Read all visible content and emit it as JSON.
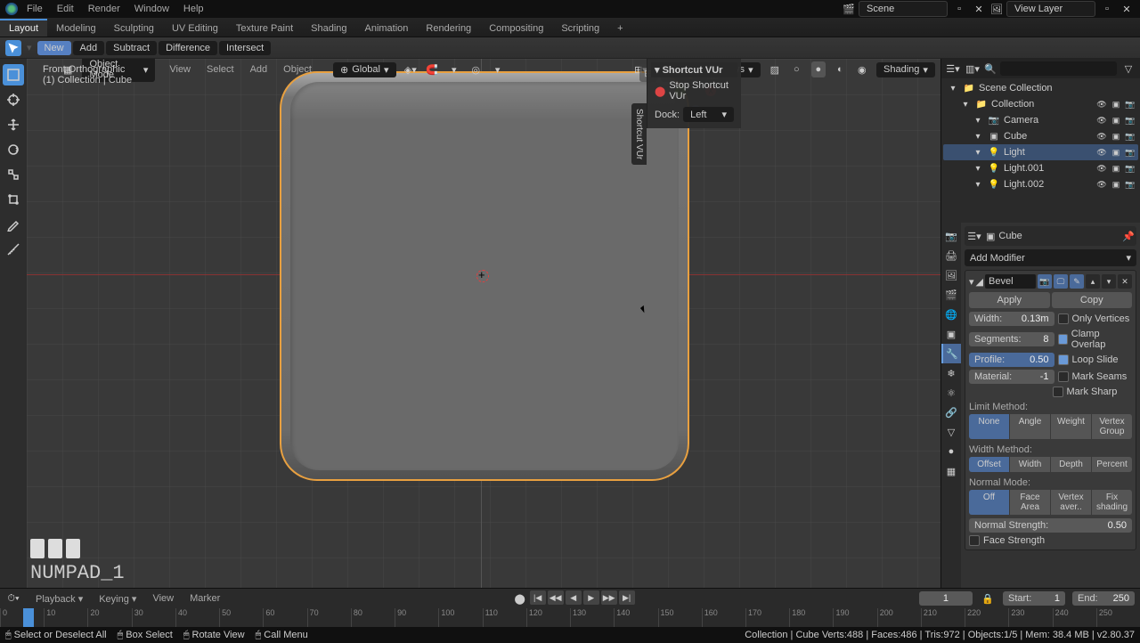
{
  "menu": [
    "File",
    "Edit",
    "Render",
    "Window",
    "Help"
  ],
  "workspaces": [
    "Layout",
    "Modeling",
    "Sculpting",
    "UV Editing",
    "Texture Paint",
    "Shading",
    "Animation",
    "Rendering",
    "Compositing",
    "Scripting"
  ],
  "active_ws": "Layout",
  "scene": "Scene",
  "view_layer": "View Layer",
  "bool_ops": [
    "New",
    "Add",
    "Subtract",
    "Difference",
    "Intersect"
  ],
  "mode": "Object Mode",
  "view_menu": [
    "View",
    "Select",
    "Add",
    "Object"
  ],
  "orient": "Global",
  "overlays": "Overlays",
  "shading": "Shading",
  "vp": {
    "view": "Front Orthographic",
    "coll": "(1) Collection | Cube"
  },
  "hotkey": "NUMPAD_1",
  "npanel": {
    "title": "Shortcut VUr",
    "stop": "Stop Shortcut VUr",
    "dock_lbl": "Dock:",
    "dock_val": "Left"
  },
  "outliner": {
    "scene": "Scene Collection",
    "collection": "Collection",
    "items": [
      {
        "name": "Camera",
        "kind": "camera"
      },
      {
        "name": "Cube",
        "kind": "mesh",
        "sel": true
      },
      {
        "name": "Light",
        "kind": "light",
        "active": true
      },
      {
        "name": "Light.001",
        "kind": "light"
      },
      {
        "name": "Light.002",
        "kind": "light"
      }
    ]
  },
  "props": {
    "obj": "Cube",
    "add_mod": "Add Modifier",
    "mod_name": "Bevel",
    "apply": "Apply",
    "copy": "Copy",
    "fields": {
      "width_lbl": "Width:",
      "width": "0.13m",
      "seg_lbl": "Segments:",
      "seg": "8",
      "prof_lbl": "Profile:",
      "prof": "0.50",
      "mat_lbl": "Material:",
      "mat": "-1",
      "only_v": "Only Vertices",
      "clamp": "Clamp Overlap",
      "loop": "Loop Slide",
      "seams": "Mark Seams",
      "sharp": "Mark Sharp"
    },
    "limit_lbl": "Limit Method:",
    "limit": [
      "None",
      "Angle",
      "Weight",
      "Vertex Group"
    ],
    "width_m_lbl": "Width Method:",
    "width_m": [
      "Offset",
      "Width",
      "Depth",
      "Percent"
    ],
    "norm_lbl": "Normal Mode:",
    "norm": [
      "Off",
      "Face Area",
      "Vertex aver..",
      "Fix shading"
    ],
    "nstr_lbl": "Normal Strength:",
    "nstr": "0.50",
    "fstr": "Face Strength"
  },
  "tl": {
    "menus": [
      "Playback",
      "Keying",
      "View",
      "Marker"
    ],
    "frame": "1",
    "start_lbl": "Start:",
    "start": "1",
    "end_lbl": "End:",
    "end": "250",
    "ticks": [
      "0",
      "10",
      "20",
      "30",
      "40",
      "50",
      "60",
      "70",
      "80",
      "90",
      "100",
      "110",
      "120",
      "130",
      "140",
      "150",
      "160",
      "170",
      "180",
      "190",
      "200",
      "210",
      "220",
      "230",
      "240",
      "250"
    ]
  },
  "status": {
    "left": [
      "Select or Deselect All",
      "Box Select",
      "Rotate View",
      "Call Menu"
    ],
    "right": "Collection | Cube    Verts:488 | Faces:486 | Tris:972 | Objects:1/5 | Mem: 38.4 MB | v2.80.37"
  }
}
